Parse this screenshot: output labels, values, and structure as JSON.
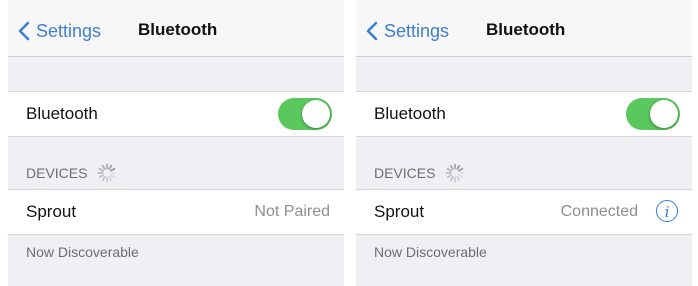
{
  "screens": [
    {
      "back_label": "Settings",
      "title": "Bluetooth",
      "bluetooth_label": "Bluetooth",
      "bluetooth_on": true,
      "devices_header": "DEVICES",
      "device_name": "Sprout",
      "device_status": "Not Paired",
      "footer": "Now Discoverable"
    },
    {
      "back_label": "Settings",
      "title": "Bluetooth",
      "bluetooth_label": "Bluetooth",
      "bluetooth_on": true,
      "devices_header": "DEVICES",
      "device_name": "Sprout",
      "device_status": "Connected",
      "footer": "Now Discoverable",
      "info_icon": "i"
    }
  ],
  "colors": {
    "accent": "#3f7fd1",
    "toggle_on": "#5ac85c",
    "background": "#efeff4"
  }
}
